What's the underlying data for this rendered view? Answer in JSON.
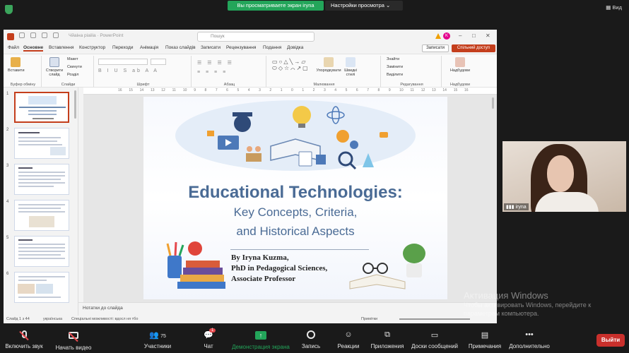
{
  "zoom": {
    "share_banner": "Вы просматриваете экран iryna",
    "view_options": "Настройки просмотра",
    "view_button": "Вид"
  },
  "ppt": {
    "doc_title": "Чйаіна ріаіііа · РоwerPoint",
    "search_placeholder": "Пошук",
    "avatar_letter": "K",
    "tabs": [
      "Файл",
      "Основне",
      "Вставлення",
      "Конструктор",
      "Переходи",
      "Анімація",
      "Показ слайдів",
      "Записати",
      "Рецензування",
      "Подання",
      "Довідка"
    ],
    "active_tab": "Основне",
    "notes_button": "Записати",
    "share_button": "Спільний доступ",
    "ribbon": {
      "paste": "Вставити",
      "new_slide": "Створити слайд",
      "layout": "Макет",
      "reset": "Скинути",
      "section": "Розділ",
      "shapes_arrange": "Упорядкувати",
      "styles": "Швидкі стилі",
      "find": "Знайти",
      "replace": "Замінити",
      "select": "Виділити",
      "addins": "Надбудови",
      "group_clipboard": "Буфер обміну",
      "group_slides": "Слайди",
      "group_font": "Шрифт",
      "group_paragraph": "Абзац",
      "group_drawing": "Малювання",
      "group_editing": "Редагування",
      "group_addins": "Надбудови"
    },
    "ruler_ticks": [
      "16",
      "15",
      "14",
      "13",
      "12",
      "11",
      "10",
      "9",
      "8",
      "7",
      "6",
      "5",
      "4",
      "3",
      "2",
      "1",
      "0",
      "1",
      "2",
      "3",
      "4",
      "5",
      "6",
      "7",
      "8",
      "9",
      "10",
      "11",
      "12",
      "13",
      "14",
      "15",
      "16"
    ],
    "slide_numbers": [
      "1",
      "2",
      "3",
      "4",
      "5",
      "6"
    ],
    "slide": {
      "title": "Educational Technologies:",
      "subtitle_1": "Key Concepts, Criteria,",
      "subtitle_2": "and Historical Aspects",
      "author_1": "By Iryna Kuzma,",
      "author_2": "PhD in Pedagogical Sciences,",
      "author_3": "Associate Professor"
    },
    "notes_placeholder": "Нотатки до слайда",
    "status_slide": "Слайд 1 з 44",
    "status_lang": "українська",
    "status_accessibility": "Спеціальні можливості: вдосл ня тбо",
    "status_notes": "Примітки"
  },
  "participant": {
    "name": "iryna"
  },
  "watermark": {
    "line1": "Активация Windows",
    "line2": "Чтобы активировать Windows, перейдите к",
    "line3": "параметрам компьютера."
  },
  "toolbar": {
    "unmute": "Включить звук",
    "start_video": "Начать видео",
    "participants": "Участники",
    "participants_count": "75",
    "chat": "Чат",
    "chat_badge": "1",
    "share_screen": "Демонстрация экрана",
    "record": "Запись",
    "reactions": "Реакции",
    "apps": "Приложения",
    "whiteboards": "Доски сообщений",
    "notes": "Примечания",
    "more": "Дополнительно",
    "leave": "Выйти"
  }
}
